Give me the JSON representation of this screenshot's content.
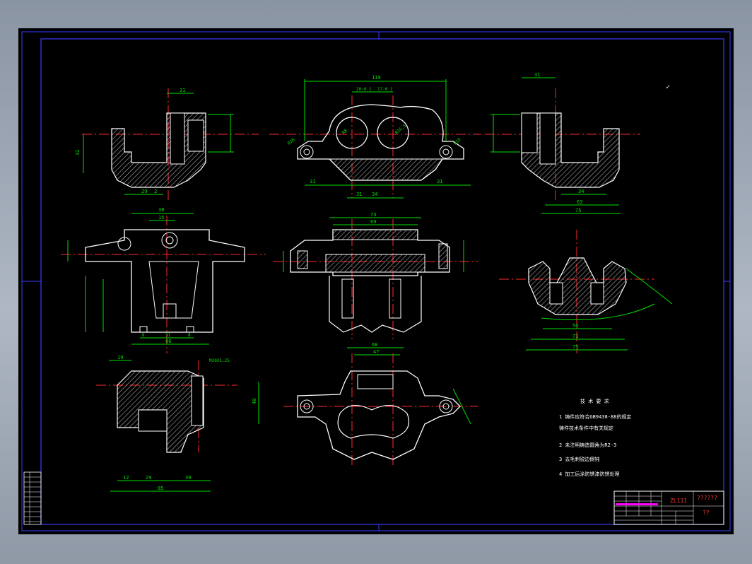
{
  "colors": {
    "background": "#000000",
    "frame": "#3b3bff",
    "outline": "#ffffff",
    "dimension": "#00e000",
    "centerline": "#ff2a2a",
    "hatch": "#ffffff",
    "text": "#ffffff",
    "title_accent": "#ff3b3b",
    "magenta": "#ff00ff"
  },
  "tech_requirements": {
    "heading": "技 术 要 求",
    "items": [
      "1  铸件应符合GB9438-88的规定",
      "   铸件技术条件中有关规定",
      "2  未注明铸造圆角为R2-3",
      "3  去毛刺锐边倒钝",
      "4  加工后涂防锈漆防锈处理"
    ]
  },
  "title_block": {
    "material": "ZL111",
    "name": "??????",
    "code": "??"
  },
  "dimensions": {
    "front_top_width": "119",
    "front_top_left": "20-0.1",
    "front_top_right": "17-0.1",
    "front_bottom": [
      "31",
      "31",
      "34",
      "31"
    ],
    "right_top": "31",
    "right_bottom": [
      "34",
      "63",
      "75"
    ],
    "left_top": "31",
    "left_bottom": [
      "29",
      "2"
    ],
    "left_height": "32",
    "mid_top_width": "73",
    "mid_second_width": "69",
    "mid_left_width": "38",
    "mid_left_sub": "15",
    "mid_left_bottom": "66",
    "mid_left_bottom_parts": [
      "8",
      "31",
      "8"
    ],
    "right_mid_bottom": [
      "50",
      "73",
      "79"
    ],
    "bottom_left_bottom": [
      "12",
      "29",
      "39",
      "85"
    ],
    "bottom_left_top": "19",
    "bottom_left_label": "M20X1.25",
    "bottom_center_top": [
      "68",
      "47"
    ],
    "bottom_center_height": "40",
    "radius_labels": [
      "R8",
      "R16.5",
      "R26",
      "R19"
    ]
  },
  "side_table": {
    "rows": [
      "",
      "",
      "",
      "",
      "",
      "",
      "",
      "",
      "",
      "",
      ""
    ]
  }
}
